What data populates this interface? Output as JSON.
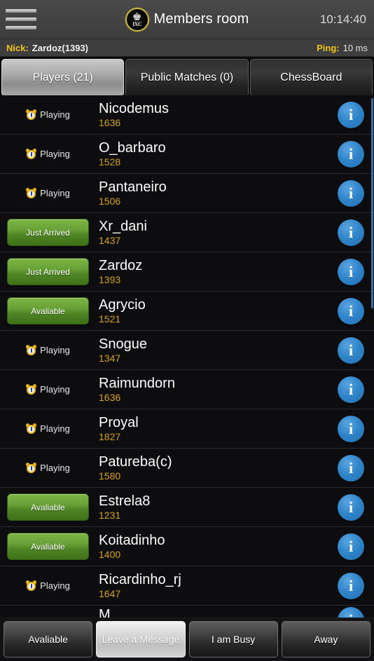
{
  "header": {
    "menu_icon": "hamburger-menu-icon",
    "logo_icon": "ixc-chess-logo-icon",
    "logo_piece_glyph": "♚",
    "logo_text": "IXC",
    "title": "Members room",
    "clock": "10:14:40"
  },
  "statusbar": {
    "nick_label": "Nick:",
    "nick_value": "Zardoz(1393)",
    "ping_label": "Ping:",
    "ping_value": "10 ms"
  },
  "tabs": [
    {
      "label": "Players (21)",
      "selected": true
    },
    {
      "label": "Public Matches (0)",
      "selected": false
    },
    {
      "label": "ChessBoard",
      "selected": false
    }
  ],
  "colors": {
    "accent_yellow": "#f0c419",
    "rating_gold": "#d6a318",
    "status_green": "#69a338",
    "info_blue": "#2f84c9",
    "scrollbar_blue": "#3f6fa8"
  },
  "players": [
    {
      "status": "Playing",
      "status_type": "playing",
      "name": "Nicodemus",
      "rating": "1636",
      "info_icon": "info-icon"
    },
    {
      "status": "Playing",
      "status_type": "playing",
      "name": "O_barbaro",
      "rating": "1528",
      "info_icon": "info-icon"
    },
    {
      "status": "Playing",
      "status_type": "playing",
      "name": "Pantaneiro",
      "rating": "1506",
      "info_icon": "info-icon"
    },
    {
      "status": "Just Arrived",
      "status_type": "pill",
      "name": "Xr_dani",
      "rating": "1437",
      "info_icon": "info-icon"
    },
    {
      "status": "Just Arrived",
      "status_type": "pill",
      "name": "Zardoz",
      "rating": "1393",
      "info_icon": "info-icon"
    },
    {
      "status": "Avaliable",
      "status_type": "pill",
      "name": "Agrycio",
      "rating": "1521",
      "info_icon": "info-icon"
    },
    {
      "status": "Playing",
      "status_type": "playing",
      "name": "Snogue",
      "rating": "1347",
      "info_icon": "info-icon"
    },
    {
      "status": "Playing",
      "status_type": "playing",
      "name": "Raimundorn",
      "rating": "1636",
      "info_icon": "info-icon"
    },
    {
      "status": "Playing",
      "status_type": "playing",
      "name": "Proyal",
      "rating": "1827",
      "info_icon": "info-icon"
    },
    {
      "status": "Playing",
      "status_type": "playing",
      "name": "Patureba(c)",
      "rating": "1580",
      "info_icon": "info-icon"
    },
    {
      "status": "Avaliable",
      "status_type": "pill",
      "name": "Estrela8",
      "rating": "1231",
      "info_icon": "info-icon"
    },
    {
      "status": "Avaliable",
      "status_type": "pill",
      "name": "Koitadinho",
      "rating": "1400",
      "info_icon": "info-icon"
    },
    {
      "status": "Playing",
      "status_type": "playing",
      "name": "Ricardinho_rj",
      "rating": "1647",
      "info_icon": "info-icon"
    },
    {
      "status": "",
      "status_type": "none",
      "name": "M",
      "rating": "",
      "info_icon": "info-icon"
    }
  ],
  "actions": [
    {
      "label": "Avaliable",
      "highlight": false
    },
    {
      "label": "Leave a Message",
      "highlight": true
    },
    {
      "label": "I am Busy",
      "highlight": false
    },
    {
      "label": "Away",
      "highlight": false
    }
  ]
}
